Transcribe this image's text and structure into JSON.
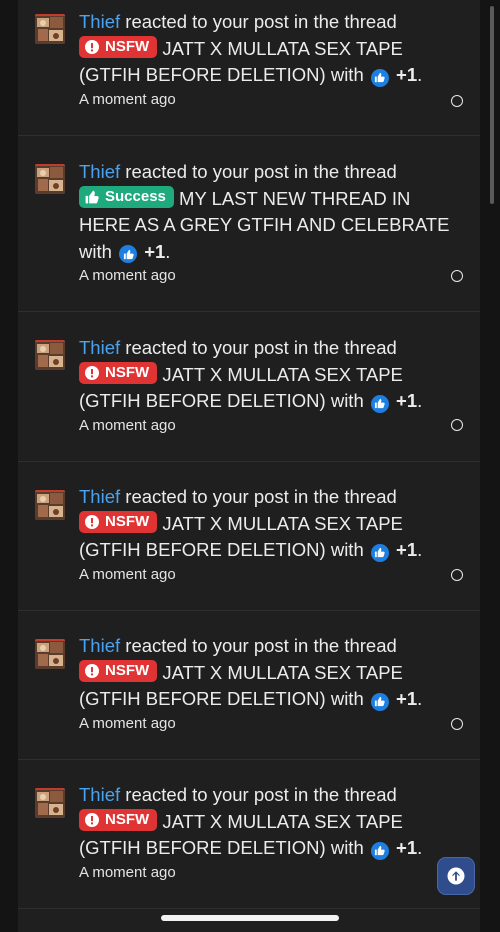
{
  "notifications": [
    {
      "user": "Thief",
      "action": "reacted to your post in the thread",
      "prefix": "NSFW",
      "thread_title": "JATT X MULLATA SEX TAPE (GTFIH BEFORE DELETION)",
      "with_text": "with",
      "reaction_count": "+1",
      "end": ".",
      "time": "A moment ago"
    },
    {
      "user": "Thief",
      "action": "reacted to your post in the thread",
      "prefix": "Success",
      "thread_title": "MY LAST NEW THREAD IN HERE AS A GREY GTFIH AND CELEBRATE",
      "with_text": "with",
      "reaction_count": "+1",
      "end": ".",
      "time": "A moment ago"
    },
    {
      "user": "Thief",
      "action": "reacted to your post in the thread",
      "prefix": "NSFW",
      "thread_title": "JATT X MULLATA SEX TAPE (GTFIH BEFORE DELETION)",
      "with_text": "with",
      "reaction_count": "+1",
      "end": ".",
      "time": "A moment ago"
    },
    {
      "user": "Thief",
      "action": "reacted to your post in the thread",
      "prefix": "NSFW",
      "thread_title": "JATT X MULLATA SEX TAPE (GTFIH BEFORE DELETION)",
      "with_text": "with",
      "reaction_count": "+1",
      "end": ".",
      "time": "A moment ago"
    },
    {
      "user": "Thief",
      "action": "reacted to your post in the thread",
      "prefix": "NSFW",
      "thread_title": "JATT X MULLATA SEX TAPE (GTFIH BEFORE DELETION)",
      "with_text": "with",
      "reaction_count": "+1",
      "end": ".",
      "time": "A moment ago"
    },
    {
      "user": "Thief",
      "action": "reacted to your post in the thread",
      "prefix": "NSFW",
      "thread_title": "JATT X MULLATA SEX TAPE (GTFIH BEFORE DELETION)",
      "with_text": "with",
      "reaction_count": "+1",
      "end": ".",
      "time": "A moment ago"
    }
  ],
  "icons": {
    "nsfw_prefix": "exclamation-circle-icon",
    "success_prefix": "thumbs-up-icon",
    "reaction": "like-reaction-icon",
    "scroll_top": "arrow-up-icon",
    "read_toggle": "unread-circle-icon"
  },
  "colors": {
    "username": "#4aa3f0",
    "nsfw_badge": "#e03434",
    "success_badge": "#1faa7d",
    "reaction": "#1d7fe0",
    "scroll_top_button": "#2f4d8c"
  }
}
